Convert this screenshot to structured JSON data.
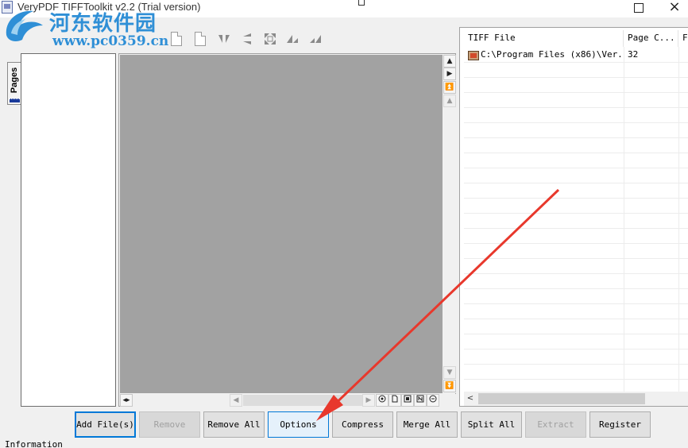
{
  "window": {
    "title": "VeryPDF TIFFToolkit v2.2 (Trial version)",
    "close_glyph": "×"
  },
  "watermark": {
    "name": "河东软件园",
    "url": "www.pc0359.cn"
  },
  "toolbar": {
    "icons": [
      "page-icon",
      "page-icon",
      "flip-horizontal-icon",
      "flip-vertical-icon",
      "rotate-icon",
      "rotate-left-icon",
      "rotate-right-icon"
    ]
  },
  "sidebar": {
    "tab_label": "Pages"
  },
  "viewer": {
    "scroll_glyphs": {
      "up": "▲",
      "right": "▶",
      "first": "⏫",
      "down": "▼",
      "last": "⏬",
      "left": "◀",
      "width": "◂▸"
    }
  },
  "file_list": {
    "columns": [
      "TIFF File",
      "Page C...",
      "F"
    ],
    "rows": [
      {
        "file": "C:\\Program Files (x86)\\Ver...",
        "pages": "32"
      }
    ],
    "scroll_left": "<"
  },
  "buttons": {
    "add_files": "Add File(s)",
    "remove": "Remove",
    "remove_all": "Remove All",
    "options": "Options",
    "compress": "Compress",
    "merge_all": "Merge All",
    "split_all": "Split All",
    "extract": "Extract",
    "register": "Register"
  },
  "status": {
    "info_label": "Information"
  },
  "colors": {
    "canvas": "#a2a2a2",
    "accent": "#0078d7",
    "annotation": "#e8382c",
    "watermark": "#2f8fd6"
  }
}
